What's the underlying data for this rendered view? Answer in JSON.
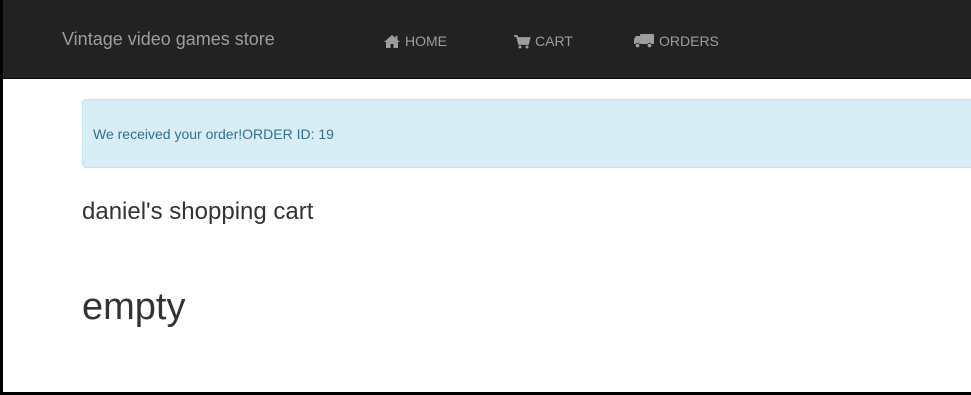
{
  "navbar": {
    "brand": "Vintage video games store",
    "items": [
      {
        "label": "HOME",
        "icon": "home-icon"
      },
      {
        "label": "CART",
        "icon": "cart-icon"
      },
      {
        "label": "ORDERS",
        "icon": "truck-icon"
      }
    ],
    "background": "#222222",
    "text_color": "#9d9d9d"
  },
  "alert": {
    "message": "We received your order!ORDER ID: 19",
    "background": "#d9edf7",
    "text_color": "#31708f"
  },
  "cart": {
    "title": "daniel's shopping cart",
    "status": "empty"
  }
}
